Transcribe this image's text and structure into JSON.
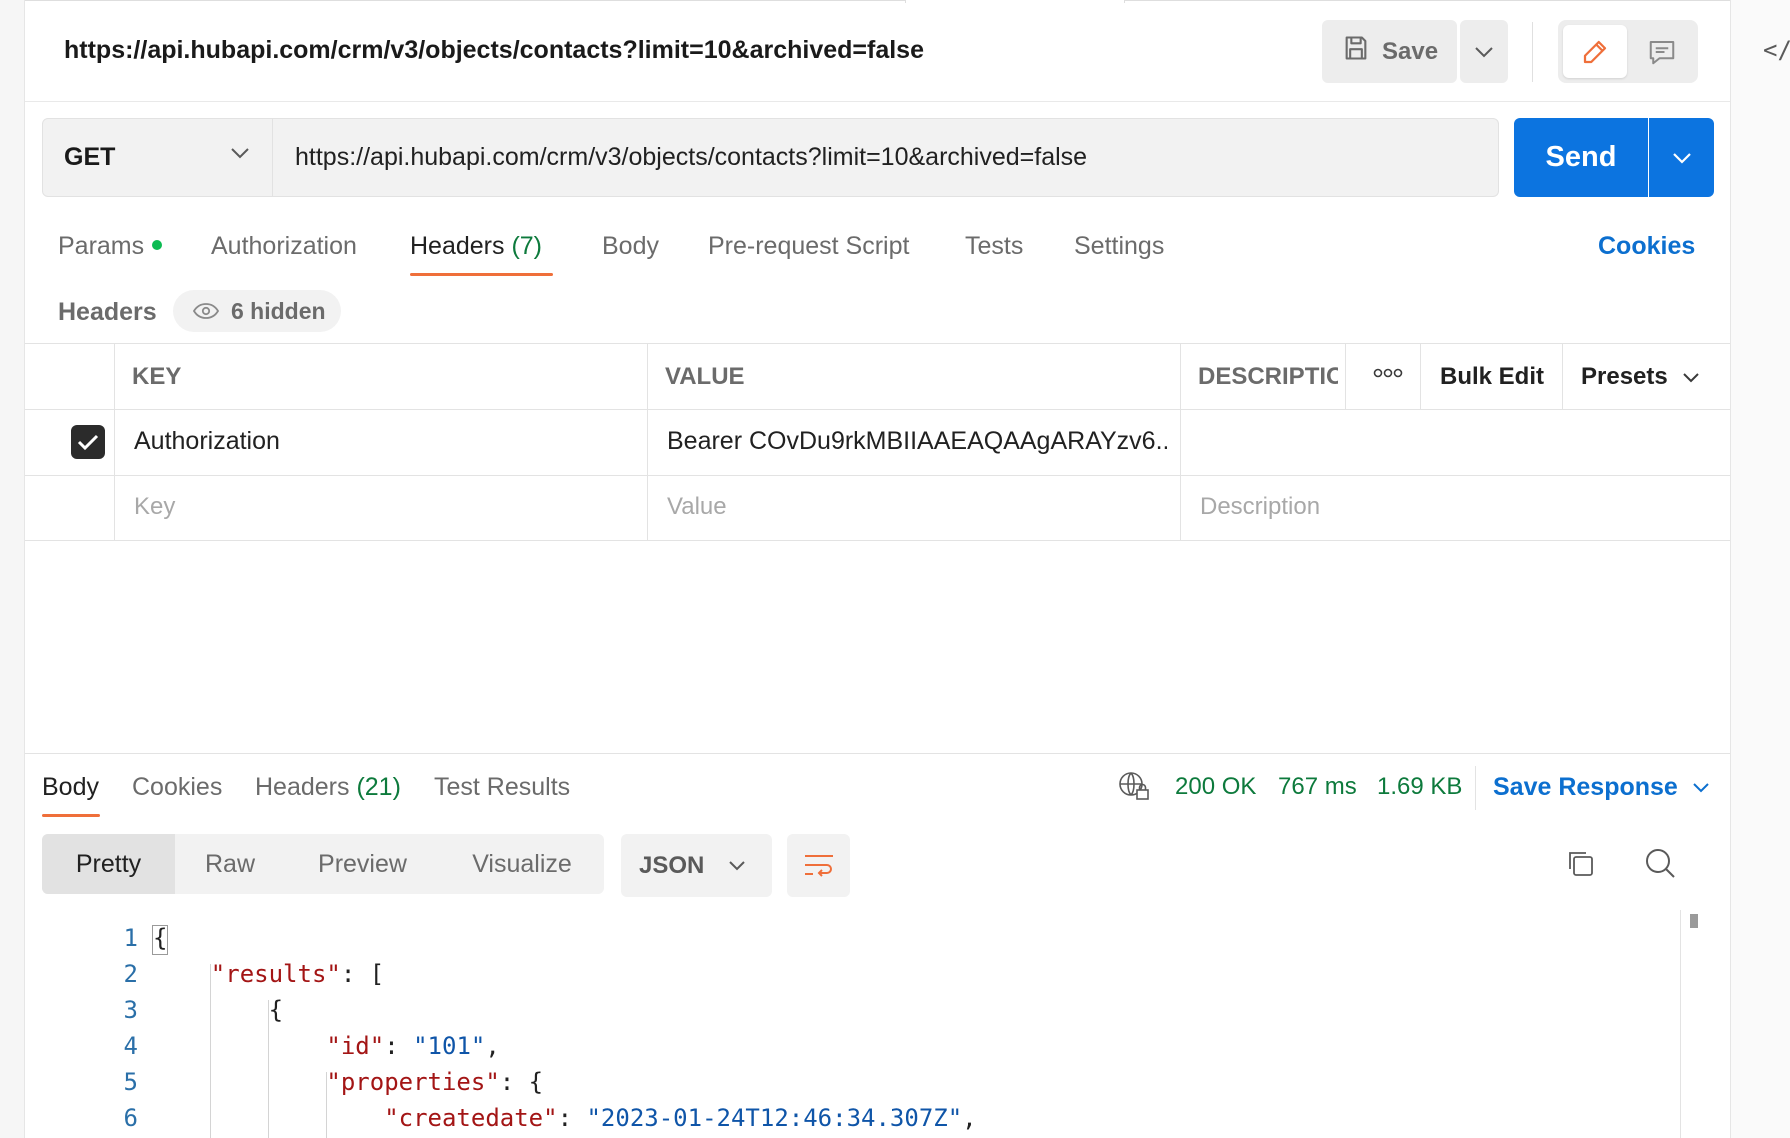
{
  "request": {
    "title": "https://api.hubapi.com/crm/v3/objects/contacts?limit=10&archived=false",
    "method": "GET",
    "url": "https://api.hubapi.com/crm/v3/objects/contacts?limit=10&archived=false",
    "save_label": "Save",
    "send_label": "Send"
  },
  "request_tabs": {
    "params": "Params",
    "authorization": "Authorization",
    "headers": "Headers",
    "headers_count": "(7)",
    "body": "Body",
    "pre_request_script": "Pre-request Script",
    "tests": "Tests",
    "settings": "Settings",
    "cookies": "Cookies",
    "active": "headers"
  },
  "headers_section": {
    "label": "Headers",
    "hidden_label": "6 hidden",
    "columns": {
      "key": "KEY",
      "value": "VALUE",
      "description": "DESCRIPTIO"
    },
    "bulk_edit": "Bulk Edit",
    "presets": "Presets",
    "rows": [
      {
        "checked": true,
        "key": "Authorization",
        "value": "Bearer COvDu9rkMBIIAAEAQAAgARAYzv6...",
        "description": ""
      }
    ],
    "placeholders": {
      "key": "Key",
      "value": "Value",
      "description": "Description"
    }
  },
  "response_tabs": {
    "body": "Body",
    "cookies": "Cookies",
    "headers": "Headers",
    "headers_count": "(21)",
    "test_results": "Test Results",
    "active": "body"
  },
  "response_status": {
    "status": "200 OK",
    "time": "767 ms",
    "size": "1.69 KB",
    "save_response": "Save Response"
  },
  "response_view": {
    "modes": [
      "Pretty",
      "Raw",
      "Preview",
      "Visualize"
    ],
    "active_mode": "Pretty",
    "format": "JSON"
  },
  "code_lines": {
    "l1": {
      "num": "1",
      "brace": "{"
    },
    "l2": {
      "num": "2",
      "key": "\"results\"",
      "rest": ": ["
    },
    "l3": {
      "num": "3",
      "text": "{"
    },
    "l4": {
      "num": "4",
      "key": "\"id\"",
      "sep": ": ",
      "val": "\"101\"",
      "tail": ","
    },
    "l5": {
      "num": "5",
      "key": "\"properties\"",
      "rest": ": {"
    },
    "l6": {
      "num": "6",
      "key": "\"createdate\"",
      "sep": ": ",
      "val": "\"2023-01-24T12:46:34.307Z\"",
      "tail": ","
    }
  },
  "colors": {
    "send_blue": "#0c74e0",
    "link_blue": "#0c6fcf",
    "active_tab_orange": "#ef6f3a",
    "status_green": "#0d7a3c",
    "params_dot_green": "#0cbb52",
    "json_key_red": "#a31515",
    "json_string_blue": "#0f55a8"
  },
  "icons": {
    "save": "floppy-disk-icon",
    "edit": "pencil-icon",
    "comment": "comment-icon",
    "hidden": "eye-icon",
    "network": "globe-lock-icon",
    "wrap": "wrap-lines-icon",
    "copy": "copy-icon",
    "search": "search-icon",
    "code": "code-icon"
  }
}
